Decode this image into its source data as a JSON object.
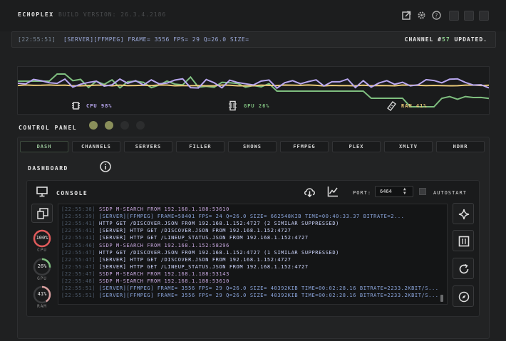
{
  "app": {
    "name": "ECHOPLEX",
    "build_version": "BUILD VERSION: 26.3.4.2186"
  },
  "status": {
    "time": "[22:55:51]",
    "message": "[SERVER][FFMPEG] FRAME= 3556 FPS= 29 Q=26.0 SIZE=",
    "channel_prefix": "CHANNEL #",
    "channel_number": "57",
    "channel_suffix": " UPDATED."
  },
  "resources": {
    "cpu_label": "CPU 98%",
    "gpu_label": "GPU 26%",
    "ram_label": "RAM 41%"
  },
  "control_panel": {
    "label": "CONTROL PANEL",
    "leds": [
      "on",
      "on",
      "off",
      "off"
    ]
  },
  "tabs": [
    {
      "label": "DASH",
      "active": true
    },
    {
      "label": "CHANNELS",
      "active": false
    },
    {
      "label": "SERVERS",
      "active": false
    },
    {
      "label": "FILLER",
      "active": false
    },
    {
      "label": "SHOWS",
      "active": false
    },
    {
      "label": "FFMPEG",
      "active": false
    },
    {
      "label": "PLEX",
      "active": false
    },
    {
      "label": "XMLTV",
      "active": false
    },
    {
      "label": "HDHR",
      "active": false
    }
  ],
  "dashboard": {
    "label": "DASHBOARD"
  },
  "console": {
    "label": "CONSOLE",
    "port_label": "PORT:",
    "port_value": "6464",
    "autostart_label": "AUTOSTART",
    "autostart_checked": false,
    "log": [
      {
        "ts": "[22:55:38]",
        "kind": "ssdp",
        "msg": "SSDP M-SEARCH FROM 192.168.1.188:53610"
      },
      {
        "ts": "[22:55:39]",
        "kind": "ffmpeg",
        "msg": "[SERVER][FFMPEG] FRAME=58401 FPS= 24 Q=26.0 SIZE=  662548KIB TIME=00:40:33.37 BITRATE=2..."
      },
      {
        "ts": "[22:55:41]",
        "kind": "server",
        "msg": "HTTP GET /DISCOVER.JSON FROM 192.168.1.152:4727 (2 SIMILAR SUPPRESSED)"
      },
      {
        "ts": "[22:55:41]",
        "kind": "server",
        "msg": "[SERVER] HTTP GET /DISCOVER.JSON FROM 192.168.1.152:4727"
      },
      {
        "ts": "[22:55:41]",
        "kind": "server",
        "msg": "[SERVER] HTTP GET /LINEUP_STATUS.JSON FROM 192.168.1.152:4727"
      },
      {
        "ts": "[22:55:46]",
        "kind": "ssdp",
        "msg": "SSDP M-SEARCH FROM 192.168.1.152:58296"
      },
      {
        "ts": "[22:55:47]",
        "kind": "server",
        "msg": "HTTP GET /DISCOVER.JSON FROM 192.168.1.152:4727 (1 SIMILAR SUPPRESSED)"
      },
      {
        "ts": "[22:55:47]",
        "kind": "server",
        "msg": "[SERVER] HTTP GET /DISCOVER.JSON FROM 192.168.1.152:4727"
      },
      {
        "ts": "[22:55:47]",
        "kind": "server",
        "msg": "[SERVER] HTTP GET /LINEUP_STATUS.JSON FROM 192.168.1.152:4727"
      },
      {
        "ts": "[22:55:47]",
        "kind": "ssdp",
        "msg": "SSDP M-SEARCH FROM 192.168.1.188:53143"
      },
      {
        "ts": "[22:55:48]",
        "kind": "ssdp",
        "msg": "SSDP M-SEARCH FROM 192.168.1.188:53610"
      },
      {
        "ts": "[22:55:51]",
        "kind": "ffmpeg",
        "msg": "[SERVER][FFMPEG] FRAME= 3556 FPS= 29 Q=26.0 SIZE=   40392KIB TIME=00:02:28.16 BITRATE=2233.2KBIT/S..."
      },
      {
        "ts": "[22:55:51]",
        "kind": "ffmpeg",
        "msg": "[SERVER][FFMPEG] FRAME= 3556 FPS= 29 Q=26.0 SIZE=   40392KIB TIME=00:02:28.16 BITRATE=2233.2KBIT/S..."
      }
    ]
  },
  "gauges": [
    {
      "name": "cpu",
      "value": "100%",
      "label": "CPU",
      "fraction": 1.0,
      "color": "#e05a5a"
    },
    {
      "name": "gpu",
      "value": "26%",
      "label": "GPU",
      "fraction": 0.26,
      "color": "#7fbf7f"
    },
    {
      "name": "ram",
      "value": "41%",
      "label": "RAM",
      "fraction": 0.41,
      "color": "#d9a0a0"
    }
  ],
  "colors": {
    "cpu_line": "#b9a8f0",
    "gpu_line": "#7fbf7f",
    "ram_line": "#e8c878",
    "led_on": "#8a8f5a",
    "led_off": "#2c2d2e"
  },
  "icons": {
    "title": [
      "external-link-icon",
      "gear-icon",
      "help-icon"
    ],
    "side": [
      "sparkle-icon",
      "bracket-box-icon",
      "refresh-icon",
      "compass-icon"
    ]
  }
}
